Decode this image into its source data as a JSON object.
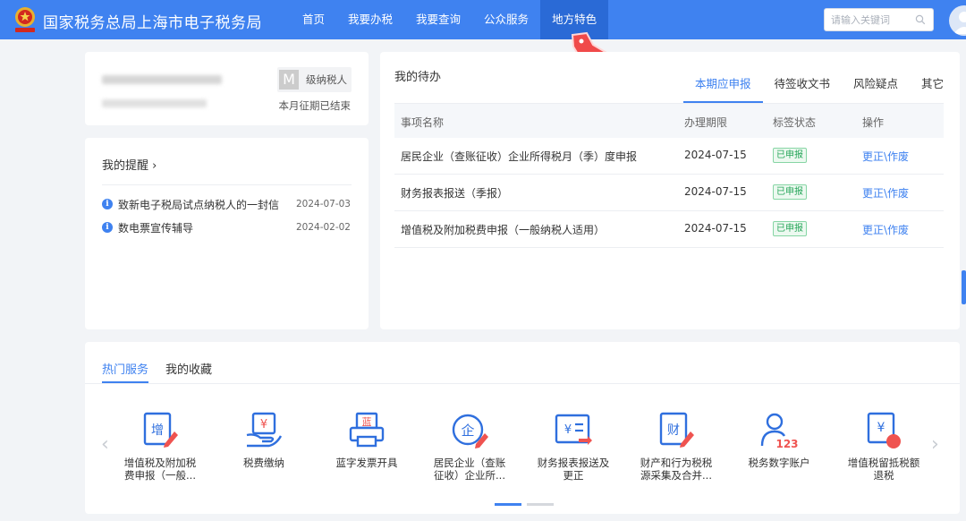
{
  "header": {
    "brand": "国家税务总局上海市电子税务局",
    "nav": [
      "首页",
      "我要办税",
      "我要查询",
      "公众服务",
      "地方特色"
    ],
    "active_nav": "地方特色",
    "search_placeholder": "请输入关键词",
    "accent": "#3f82f0"
  },
  "profile": {
    "badge_letter": "M",
    "taxpayer_level": "级纳税人",
    "period_status": "本月征期已结束"
  },
  "reminder": {
    "title": "我的提醒",
    "items": [
      {
        "text": "致新电子税局试点纳税人的一封信",
        "date": "2024-07-03"
      },
      {
        "text": "数电票宣传辅导",
        "date": "2024-02-02"
      }
    ]
  },
  "todo": {
    "title": "我的待办",
    "tabs": [
      "本期应申报",
      "待签收文书",
      "风险疑点",
      "其它"
    ],
    "active_tab": "本期应申报",
    "columns": [
      "事项名称",
      "办理期限",
      "标签状态",
      "操作"
    ],
    "rows": [
      {
        "name": "居民企业（查账征收）企业所得税月（季）度申报",
        "deadline": "2024-07-15",
        "status": "已申报",
        "action": "更正\\作废"
      },
      {
        "name": "财务报表报送（季报）",
        "deadline": "2024-07-15",
        "status": "已申报",
        "action": "更正\\作废"
      },
      {
        "name": "增值税及附加税费申报（一般纳税人适用）",
        "deadline": "2024-07-15",
        "status": "已申报",
        "action": "更正\\作废"
      }
    ]
  },
  "hot": {
    "tabs": [
      "热门服务",
      "我的收藏"
    ],
    "active_tab": "热门服务",
    "services": [
      {
        "line1": "增值税及附加税",
        "line2": "费申报（一般...",
        "icon": "vat-declare-icon",
        "glyph": "增"
      },
      {
        "line1": "税费缴纳",
        "line2": "",
        "icon": "tax-payment-icon",
        "glyph": "¥"
      },
      {
        "line1": "蓝字发票开具",
        "line2": "",
        "icon": "invoice-print-icon",
        "glyph": "蓝"
      },
      {
        "line1": "居民企业（查账",
        "line2": "征收）企业所...",
        "icon": "enterprise-tax-icon",
        "glyph": "企"
      },
      {
        "line1": "财务报表报送及",
        "line2": "更正",
        "icon": "financial-report-icon",
        "glyph": "¥"
      },
      {
        "line1": "财产和行为税税",
        "line2": "源采集及合并...",
        "icon": "property-tax-icon",
        "glyph": "财"
      },
      {
        "line1": "税务数字账户",
        "line2": "",
        "icon": "digital-account-icon",
        "glyph": "123"
      },
      {
        "line1": "增值税留抵税额",
        "line2": "退税",
        "icon": "vat-refund-icon",
        "glyph": "¥"
      }
    ],
    "pagination": {
      "pages": 2,
      "current": 1
    }
  }
}
